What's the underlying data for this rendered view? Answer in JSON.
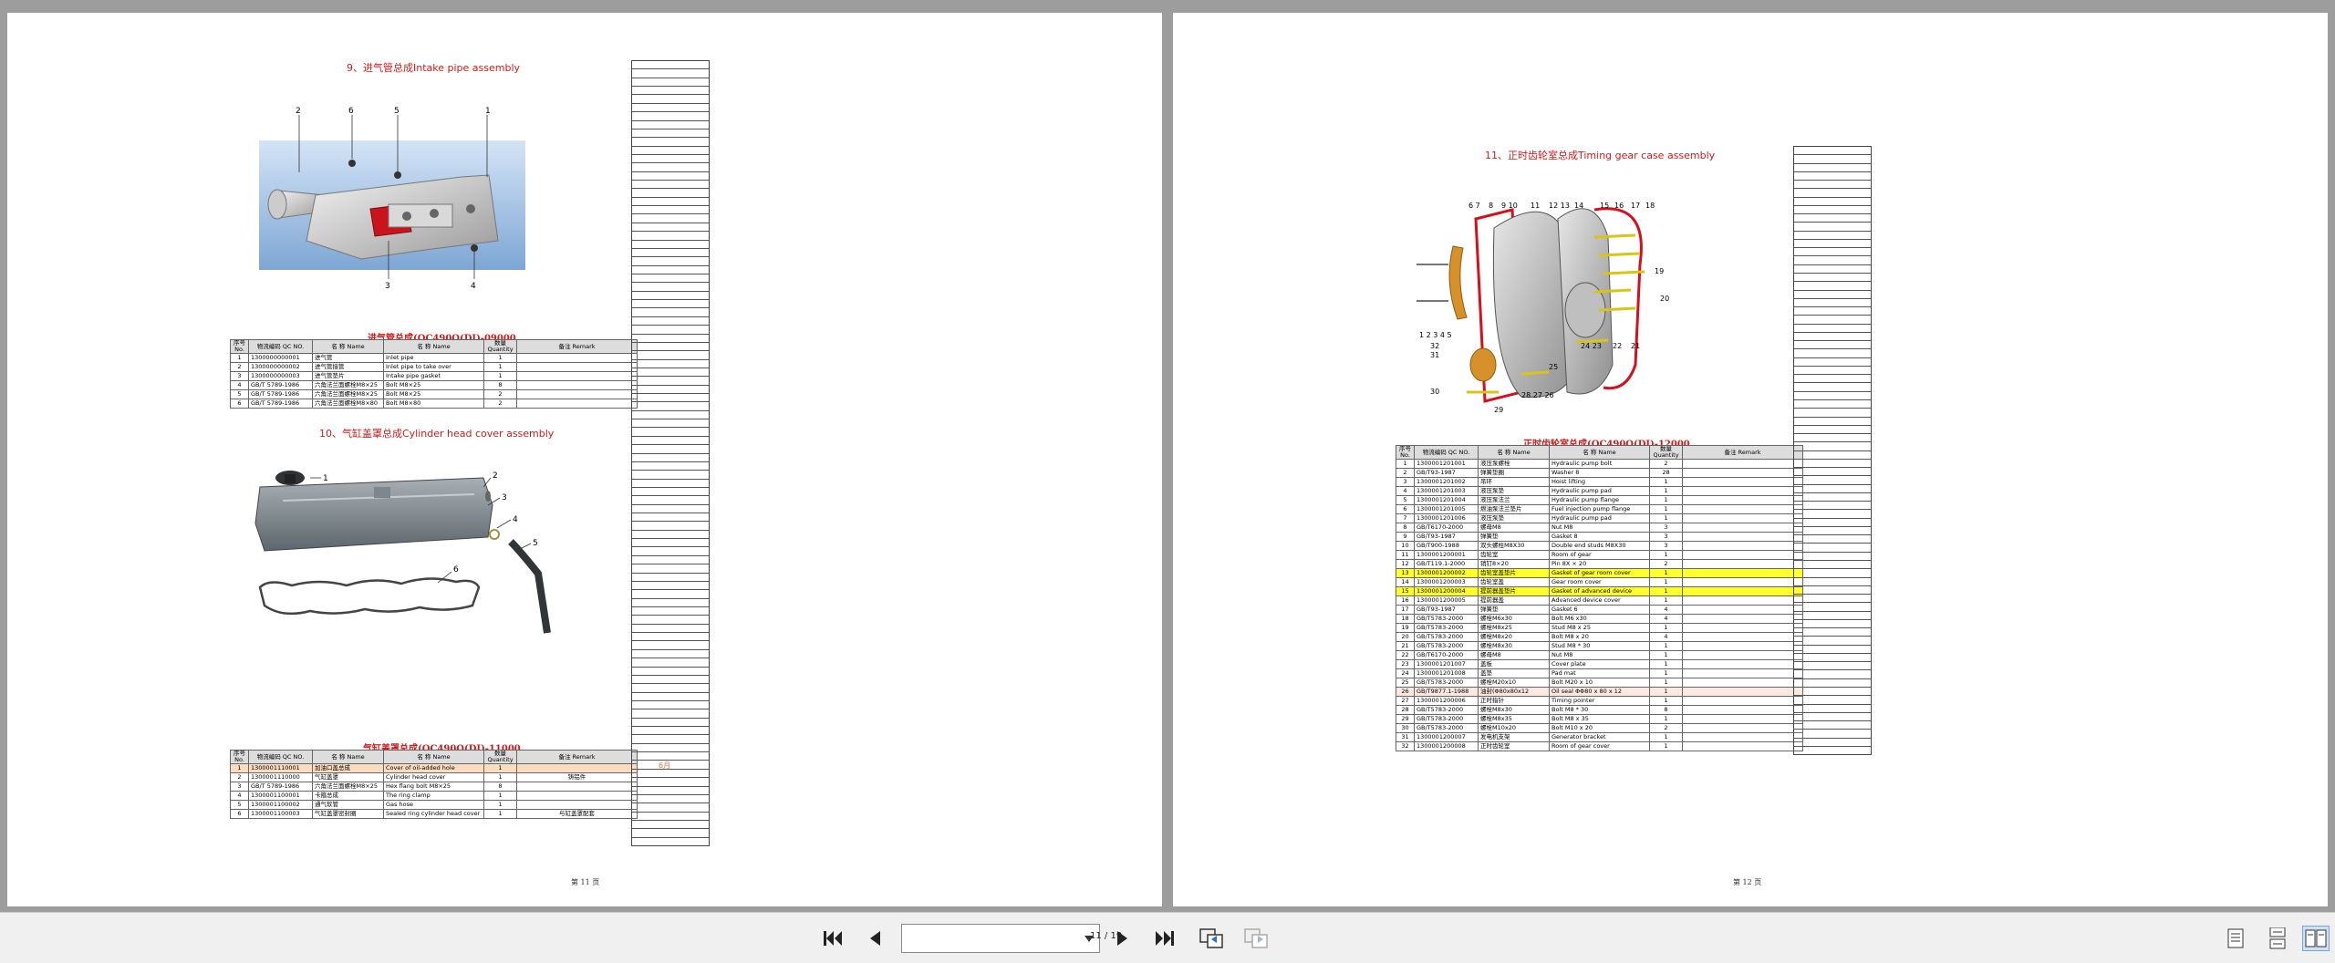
{
  "left_page": {
    "sec9_title": "9、进气管总成Intake pipe assembly",
    "sec9_table_title": "进气管总成(QC490Q(DI)-09000",
    "sec10_title": "10、气缸盖罩总成Cylinder head cover assembly",
    "sec10_table_title": "气缸盖罩总成(QC490Q(DI)-11000",
    "footer": "第 11 页",
    "sec9_callouts": [
      "2",
      "6",
      "5",
      "1",
      "3",
      "4"
    ],
    "sec10_callouts": [
      "1",
      "2",
      "3",
      "4",
      "5",
      "6"
    ],
    "sec10_note": "6月",
    "table_headers": {
      "no": "序号\nNo.",
      "qc": "物流编码\nQC NO.",
      "name_cn": "名 称\nName",
      "name_en": "名 称\nName",
      "qty": "数量\nQuantity",
      "remark": "备注\nRemark"
    },
    "sec9_rows": [
      {
        "no": "1",
        "qc": "1300000000001",
        "cn": "进气管",
        "en": "Inlet pipe",
        "qty": "1",
        "remark": ""
      },
      {
        "no": "2",
        "qc": "1300000000002",
        "cn": "进气管接管",
        "en": "Inlet pipe to take over",
        "qty": "1",
        "remark": ""
      },
      {
        "no": "3",
        "qc": "1300000000003",
        "cn": "进气管垫片",
        "en": "Intake pipe gasket",
        "qty": "1",
        "remark": ""
      },
      {
        "no": "4",
        "qc": "GB/T 5789-1986",
        "cn": "六角法兰面螺栓M8×25",
        "en": "Bolt M8×25",
        "qty": "8",
        "remark": ""
      },
      {
        "no": "5",
        "qc": "GB/T 5789-1986",
        "cn": "六角法兰面螺栓M8×25",
        "en": "Bolt M8×25",
        "qty": "2",
        "remark": ""
      },
      {
        "no": "6",
        "qc": "GB/T 5789-1986",
        "cn": "六角法兰面螺栓M8×80",
        "en": "Bolt M8×80",
        "qty": "2",
        "remark": ""
      }
    ],
    "sec10_rows": [
      {
        "no": "1",
        "qc": "1300001110001",
        "cn": "加油口盖总成",
        "en": "Cover of oil-added hole",
        "qty": "1",
        "remark": ""
      },
      {
        "no": "2",
        "qc": "1300001110000",
        "cn": "气缸盖罩",
        "en": "Cylinder head cover",
        "qty": "1",
        "remark": "铸铝件"
      },
      {
        "no": "3",
        "qc": "GB/T 5789-1986",
        "cn": "六角法兰面螺栓M8×25",
        "en": "Hex flang bolt M8×25",
        "qty": "8",
        "remark": ""
      },
      {
        "no": "4",
        "qc": "1300001100001",
        "cn": "卡箍总成",
        "en": "The ring clamp",
        "qty": "1",
        "remark": ""
      },
      {
        "no": "5",
        "qc": "1300001100002",
        "cn": "通气软管",
        "en": "Gas hose",
        "qty": "1",
        "remark": ""
      },
      {
        "no": "6",
        "qc": "1300001100003",
        "cn": "气缸盖罩密封圈",
        "en": "Sealed ring cylinder head cover",
        "qty": "1",
        "remark": "与缸盖罩配套"
      }
    ]
  },
  "right_page": {
    "sec11_title": "11、正时齿轮室总成Timing gear case assembly",
    "sec11_table_title": "正时齿轮室总成(QC490Q(DI)-12000",
    "footer": "第 12 页",
    "callouts_top": [
      "6",
      "7",
      "8",
      "9",
      "10",
      "11",
      "12",
      "13",
      "14",
      "15",
      "16",
      "17",
      "18"
    ],
    "callouts_right": [
      "19",
      "20"
    ],
    "callouts_bottom": [
      "1",
      "2",
      "3",
      "4",
      "5",
      "31",
      "32",
      "30",
      "29",
      "28",
      "27",
      "26",
      "25",
      "24",
      "23",
      "22",
      "21"
    ],
    "rows": [
      {
        "no": "1",
        "qc": "1300001201001",
        "cn": "液压泵螺栓",
        "en": "Hydraulic pump bolt",
        "qty": "2"
      },
      {
        "no": "2",
        "qc": "GB/T93-1987",
        "cn": "弹簧垫圈",
        "en": "Washer 8",
        "qty": "28"
      },
      {
        "no": "3",
        "qc": "1300001201002",
        "cn": "吊环",
        "en": "Hoist lifting",
        "qty": "1"
      },
      {
        "no": "4",
        "qc": "1300001201003",
        "cn": "液压泵垫",
        "en": "Hydraulic pump pad",
        "qty": "1"
      },
      {
        "no": "5",
        "qc": "1300001201004",
        "cn": "液压泵法兰",
        "en": "Hydraulic pump flange",
        "qty": "1"
      },
      {
        "no": "6",
        "qc": "1300001201005",
        "cn": "燃油泵法兰垫片",
        "en": "Fuel injection pump flange",
        "qty": "1"
      },
      {
        "no": "7",
        "qc": "1300001201006",
        "cn": "液压泵垫",
        "en": "Hydraulic pump pad",
        "qty": "1"
      },
      {
        "no": "8",
        "qc": "GB/T6170-2000",
        "cn": "螺母M8",
        "en": "Nut M8",
        "qty": "3"
      },
      {
        "no": "9",
        "qc": "GB/T93-1987",
        "cn": "弹簧垫",
        "en": "Gasket 8",
        "qty": "3"
      },
      {
        "no": "10",
        "qc": "GB/T900-1988",
        "cn": "双头螺柱M8X30",
        "en": "Double end studs M8X30",
        "qty": "3"
      },
      {
        "no": "11",
        "qc": "1300001200001",
        "cn": "齿轮室",
        "en": "Room of gear",
        "qty": "1"
      },
      {
        "no": "12",
        "qc": "GB/T119.1-2000",
        "cn": "销钉8×20",
        "en": "Pin 8X × 20",
        "qty": "2"
      },
      {
        "no": "13",
        "qc": "1300001200002",
        "cn": "齿轮室盖垫片",
        "en": "Gasket of gear room cover",
        "qty": "1"
      },
      {
        "no": "14",
        "qc": "1300001200003",
        "cn": "齿轮室盖",
        "en": "Gear room cover",
        "qty": "1"
      },
      {
        "no": "15",
        "qc": "1300001200004",
        "cn": "提前器盖垫片",
        "en": "Gasket of advanced device",
        "qty": "1"
      },
      {
        "no": "16",
        "qc": "1300001200005",
        "cn": "提前器盖",
        "en": "Advanced device cover",
        "qty": "1"
      },
      {
        "no": "17",
        "qc": "GB/T93-1987",
        "cn": "弹簧垫",
        "en": "Gasket 6",
        "qty": "4"
      },
      {
        "no": "18",
        "qc": "GB/T5783-2000",
        "cn": "螺栓M6x30",
        "en": "Bolt M6 x30",
        "qty": "4"
      },
      {
        "no": "19",
        "qc": "GB/T5783-2000",
        "cn": "螺栓M8x25",
        "en": "Stud M8 x 25",
        "qty": "1"
      },
      {
        "no": "20",
        "qc": "GB/T5783-2000",
        "cn": "螺栓M8x20",
        "en": "Bolt M8 x 20",
        "qty": "4"
      },
      {
        "no": "21",
        "qc": "GB/T5783-2000",
        "cn": "螺栓M8x30",
        "en": "Stud M8 * 30",
        "qty": "1"
      },
      {
        "no": "22",
        "qc": "GB/T6170-2000",
        "cn": "螺母M8",
        "en": "Nut M8",
        "qty": "1"
      },
      {
        "no": "23",
        "qc": "1300001201007",
        "cn": "盖板",
        "en": "Cover plate",
        "qty": "1"
      },
      {
        "no": "24",
        "qc": "1300001201008",
        "cn": "盖垫",
        "en": "Pad mat",
        "qty": "1"
      },
      {
        "no": "25",
        "qc": "GB/T5783-2000",
        "cn": "螺栓M20x10",
        "en": "Bolt M20 x 10",
        "qty": "1"
      },
      {
        "no": "26",
        "qc": "GB/T9877.1-1988",
        "cn": "油封(Φ80x80x12",
        "en": "Oil seal ΦΦ80 x 80 x 12",
        "qty": "1"
      },
      {
        "no": "27",
        "qc": "1300001200006",
        "cn": "正时指针",
        "en": "Timing pointer",
        "qty": "1"
      },
      {
        "no": "28",
        "qc": "GB/T5783-2000",
        "cn": "螺栓M8x30",
        "en": "Bolt M8 * 30",
        "qty": "8"
      },
      {
        "no": "29",
        "qc": "GB/T5783-2000",
        "cn": "螺栓M8x35",
        "en": "Bolt M8 x 35",
        "qty": "1"
      },
      {
        "no": "30",
        "qc": "GB/T5783-2000",
        "cn": "螺栓M10x20",
        "en": "Bolt M10 x 20",
        "qty": "2"
      },
      {
        "no": "31",
        "qc": "1300001200007",
        "cn": "发电机支架",
        "en": "Generator bracket",
        "qty": "1"
      },
      {
        "no": "32",
        "qc": "1300001200008",
        "cn": "正时齿轮室",
        "en": "Room of gear cover",
        "qty": "1"
      }
    ]
  },
  "toolbar": {
    "page_indicator": "11 / 19",
    "page_input_value": ""
  },
  "colors": {
    "title_red": "#d01a1a",
    "highlight_orange": "#fcdcbf",
    "highlight_yellow": "#ffff2a"
  }
}
